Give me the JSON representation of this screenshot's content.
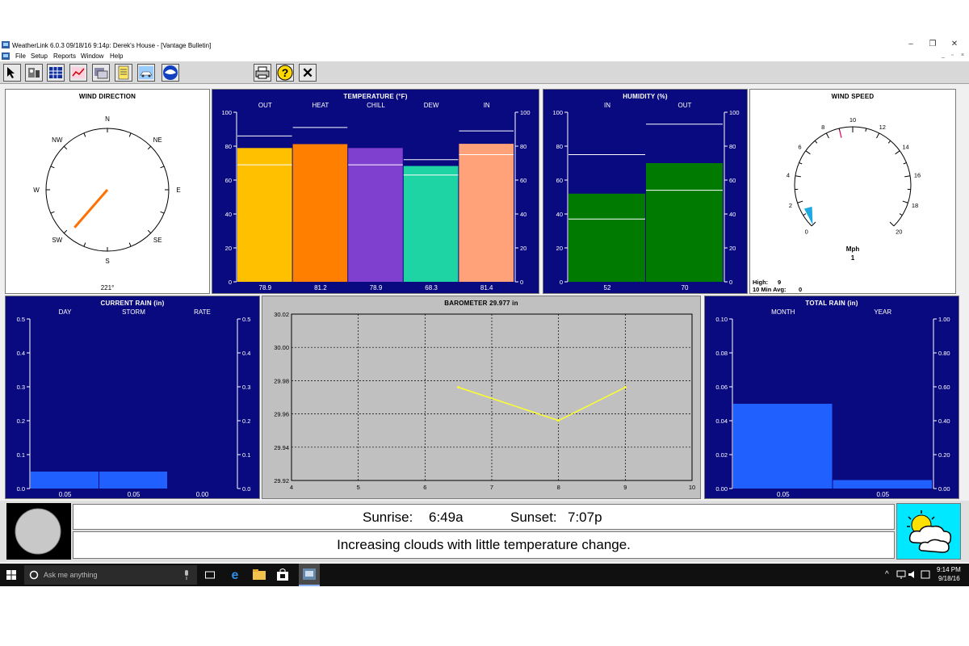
{
  "window": {
    "title": "WeatherLink 6.0.3  09/18/16  9:14p: Derek's House - [Vantage Bulletin]",
    "min": "–",
    "max": "❐",
    "close": "✕"
  },
  "menu": [
    "File",
    "Setup",
    "Reports",
    "Window",
    "Help"
  ],
  "mdi": {
    "min": "_",
    "restore": "▫",
    "close": "×"
  },
  "toolbar": {
    "left_icons": [
      "pointer-icon",
      "station-icon",
      "grid-icon",
      "graph-icon",
      "download-icon",
      "notes-icon",
      "car-icon",
      "noaa-icon"
    ],
    "right_icons": [
      "print-icon",
      "help-icon",
      "close-icon"
    ],
    "help_label": "?",
    "close_label": "✕"
  },
  "wind_direction": {
    "title": "WIND DIRECTION",
    "points": [
      "N",
      "NE",
      "E",
      "SE",
      "S",
      "SW",
      "W",
      "NW"
    ],
    "degrees": 221,
    "readout": "221°"
  },
  "temperature": {
    "title": "TEMPERATURE  (°F)",
    "ticks": [
      "100",
      "80",
      "60",
      "40",
      "20",
      "0"
    ],
    "bars": [
      {
        "label": "OUT",
        "value": 78.9,
        "display": "78.9",
        "high": 86,
        "low": 69,
        "color": "#ffc000"
      },
      {
        "label": "HEAT",
        "value": 81.2,
        "display": "81.2",
        "high": 91,
        "low": null,
        "color": "#ff7f00"
      },
      {
        "label": "CHILL",
        "value": 78.9,
        "display": "78.9",
        "high": null,
        "low": 69,
        "color": "#7f3fcf"
      },
      {
        "label": "DEW",
        "value": 68.3,
        "display": "68.3",
        "high": 72,
        "low": 63,
        "color": "#1fd4a4"
      },
      {
        "label": "IN",
        "value": 81.4,
        "display": "81.4",
        "high": 89,
        "low": 75,
        "color": "#ffa27a"
      }
    ]
  },
  "humidity": {
    "title": "HUMIDITY  (%)",
    "ticks": [
      "100",
      "80",
      "60",
      "40",
      "20",
      "0"
    ],
    "bars": [
      {
        "label": "IN",
        "value": 52,
        "display": "52",
        "high": 75,
        "low": 37,
        "color": "#007a00"
      },
      {
        "label": "OUT",
        "value": 70,
        "display": "70",
        "high": 93,
        "low": 54,
        "color": "#007a00"
      }
    ]
  },
  "wind_speed": {
    "title": "WIND SPEED",
    "scale": [
      "0",
      "2",
      "4",
      "6",
      "8",
      "10",
      "12",
      "14",
      "16",
      "18",
      "20"
    ],
    "unit": "Mph",
    "value": "1",
    "high_label": "High:",
    "high": "9",
    "avg_label": "10 Min Avg:",
    "avg": "0",
    "marker": 9
  },
  "current_rain": {
    "title": "CURRENT RAIN  (in)",
    "ticks": [
      "0.5",
      "0.4",
      "0.3",
      "0.2",
      "0.1",
      "0.0"
    ],
    "max": 0.5,
    "bars": [
      {
        "label": "DAY",
        "value": 0.05,
        "display": "0.05"
      },
      {
        "label": "STORM",
        "value": 0.05,
        "display": "0.05"
      },
      {
        "label": "RATE",
        "value": 0.0,
        "display": "0.00"
      }
    ],
    "color": "#2060ff"
  },
  "barometer": {
    "title": "BAROMETER 29.977 in",
    "chart_data": {
      "type": "line",
      "x": [
        6.5,
        8,
        9
      ],
      "y": [
        29.976,
        29.956,
        29.976
      ],
      "xlim": [
        4,
        10
      ],
      "ylim": [
        29.92,
        30.02
      ],
      "grid": true,
      "xticks": [
        "4",
        "5",
        "6",
        "7",
        "8",
        "9",
        "10"
      ],
      "yticks": [
        "30.02",
        "30.00",
        "29.98",
        "29.96",
        "29.94",
        "29.92"
      ],
      "line_color": "#ffff30"
    }
  },
  "total_rain": {
    "title": "TOTAL RAIN  (in)",
    "left_ticks": [
      "0.10",
      "0.08",
      "0.06",
      "0.04",
      "0.02",
      "0.00"
    ],
    "right_ticks": [
      "1.00",
      "0.80",
      "0.60",
      "0.40",
      "0.20",
      "0.00"
    ],
    "bars": [
      {
        "label": "MONTH",
        "value": 0.05,
        "max": 0.1,
        "display": "0.05"
      },
      {
        "label": "YEAR",
        "value": 0.05,
        "max": 1.0,
        "display": "0.05"
      }
    ],
    "color": "#2060ff"
  },
  "sun": {
    "sunrise_label": "Sunrise:",
    "sunrise": "6:49a",
    "sunset_label": "Sunset:",
    "sunset": "7:07p"
  },
  "forecast": {
    "text": "Increasing clouds with little temperature change.",
    "icon": "partly-cloudy-icon"
  },
  "moon": {
    "icon": "moon-icon"
  },
  "taskbar": {
    "search_placeholder": "Ask me anything",
    "time": "9:14 PM",
    "date": "9/18/16",
    "apps": [
      "task-view-icon",
      "edge-icon",
      "file-explorer-icon",
      "store-icon",
      "weatherlink-icon"
    ]
  }
}
